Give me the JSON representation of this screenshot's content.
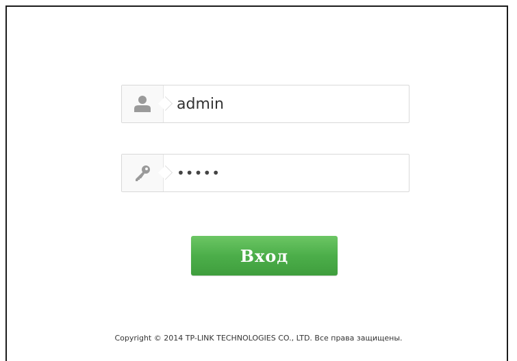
{
  "login": {
    "username_value": "admin",
    "password_value": "•••••",
    "submit_label": "Вход",
    "username_icon": "user-icon",
    "password_icon": "key-icon"
  },
  "footer": {
    "copyright": "Copyright © 2014 TP-LINK TECHNOLOGIES CO., LTD. Все права защищены."
  },
  "colors": {
    "button_green": "#4cae4a",
    "field_border": "#d8d8d8",
    "icon_gray": "#9a9a9a"
  }
}
